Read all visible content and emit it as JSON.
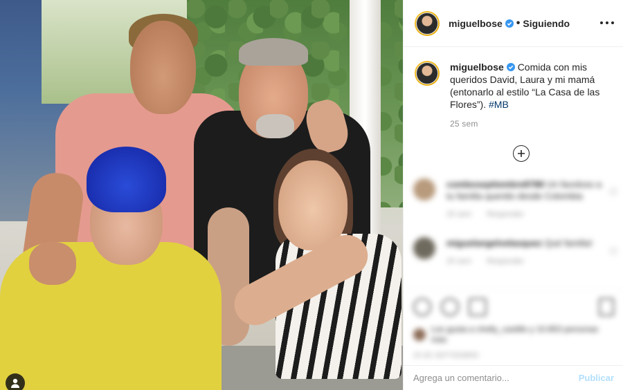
{
  "post": {
    "username": "miguelbose",
    "follow_status": "Siguiendo",
    "caption_text": "Comida con mis queridos David, Laura y mi mamá (entonarlo al estilo “La Casa de las Flores”).",
    "hashtag": "#MB",
    "time_ago": "25 sem"
  },
  "comments": [
    {
      "author": "comboseptiembre8788",
      "text": "Un favoloso a tu familia querido desde Colombia",
      "time": "25 sem",
      "reply": "Responder"
    },
    {
      "author": "miguelangelvelasquez",
      "text": "Qué familia!",
      "time": "25 sem",
      "reply": "Responder"
    }
  ],
  "likes": {
    "text": "Les gusta a chelly_castillo y 10.853 personas más"
  },
  "date": "25 DE SEPTIEMBRE",
  "comment_box": {
    "placeholder": "Agrega un comentario...",
    "publish_label": "Publicar"
  },
  "colors": {
    "verified": "#3897f0",
    "hashtag": "#00376b",
    "publish_disabled": "#b2dffc",
    "muted": "#8e8e8e"
  },
  "icons": [
    "user-tag-icon",
    "verified-icon",
    "more-options-icon",
    "load-more-comments-icon",
    "like-icon",
    "comment-icon",
    "share-icon",
    "save-icon"
  ]
}
